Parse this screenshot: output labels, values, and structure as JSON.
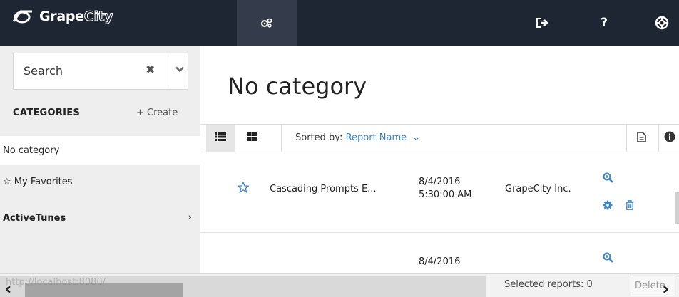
{
  "brand": {
    "name_a": "Grape",
    "name_b": "C",
    "name_c": "ity"
  },
  "topbar": {
    "icons": [
      "settings-cogs-icon",
      "logout-icon",
      "help-icon",
      "support-lifebuoy-icon"
    ],
    "help_label": "?"
  },
  "sidebar": {
    "search_placeholder": "Search",
    "clear_symbol": "✖",
    "categories_title": "CATEGORIES",
    "create_label": "+ Create",
    "items": [
      {
        "label": "No category",
        "selected": true
      },
      {
        "label": "☆ My Favorites"
      },
      {
        "label": "ActiveTunes",
        "bold": true,
        "chevron": "›"
      }
    ]
  },
  "main": {
    "title": "No category",
    "sort_prefix": "Sorted by:",
    "sort_value": "Report Name",
    "sort_chevron": "⌄",
    "rows": [
      {
        "name": "Cascading Prompts E...",
        "date": "8/4/2016",
        "time": "5:30:00 AM",
        "owner": "GrapeCity Inc."
      },
      {
        "name": "",
        "date": "8/4/2016",
        "time": "",
        "owner": ""
      }
    ]
  },
  "status": {
    "url_tip": "http://localhost:8080/",
    "selected_label": "Selected reports: 0",
    "delete_label": "Delete"
  },
  "colors": {
    "topbar": "#1f2633",
    "accent": "#3a84c9",
    "sidebar": "#eeeeee"
  }
}
